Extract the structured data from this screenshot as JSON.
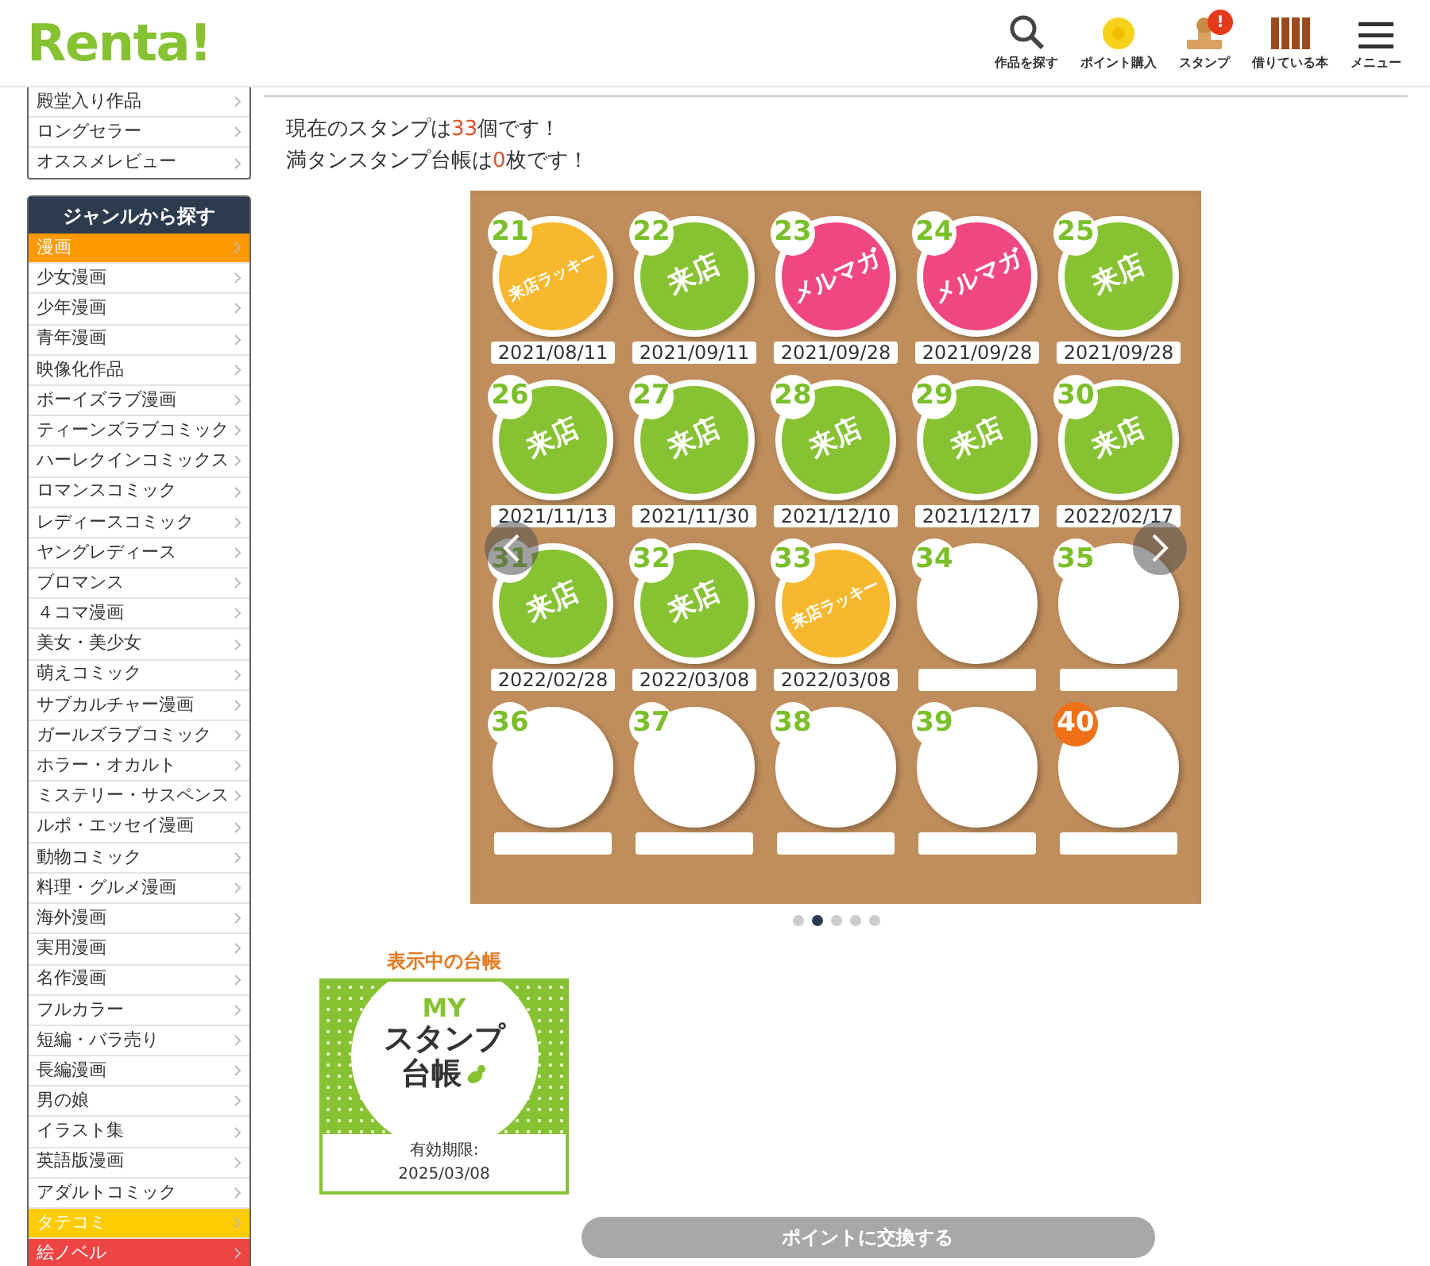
{
  "header": {
    "logo": "Renta!",
    "nav": [
      {
        "kind": "search",
        "label": "作品を探す"
      },
      {
        "kind": "coin",
        "label": "ポイント購入"
      },
      {
        "kind": "stamp",
        "label": "スタンプ",
        "badge": "!"
      },
      {
        "kind": "books",
        "label": "借りている本"
      },
      {
        "kind": "menu",
        "label": "メニュー"
      }
    ]
  },
  "sidebar": {
    "top_items": [
      {
        "label": "殿堂入り作品"
      },
      {
        "label": "ロングセラー"
      },
      {
        "label": "オススメレビュー"
      }
    ],
    "genre_title": "ジャンルから探す",
    "genres": [
      {
        "label": "漫画",
        "color": "#ff9900"
      },
      {
        "label": "少女漫画"
      },
      {
        "label": "少年漫画"
      },
      {
        "label": "青年漫画"
      },
      {
        "label": "映像化作品"
      },
      {
        "label": "ボーイズラブ漫画"
      },
      {
        "label": "ティーンズラブコミック"
      },
      {
        "label": "ハーレクインコミックス"
      },
      {
        "label": "ロマンスコミック"
      },
      {
        "label": "レディースコミック"
      },
      {
        "label": "ヤングレディース"
      },
      {
        "label": "ブロマンス"
      },
      {
        "label": "４コマ漫画"
      },
      {
        "label": "美女・美少女"
      },
      {
        "label": "萌えコミック"
      },
      {
        "label": "サブカルチャー漫画"
      },
      {
        "label": "ガールズラブコミック"
      },
      {
        "label": "ホラー・オカルト"
      },
      {
        "label": "ミステリー・サスペンス"
      },
      {
        "label": "ルポ・エッセイ漫画"
      },
      {
        "label": "動物コミック"
      },
      {
        "label": "料理・グルメ漫画"
      },
      {
        "label": "海外漫画"
      },
      {
        "label": "実用漫画"
      },
      {
        "label": "名作漫画"
      },
      {
        "label": "フルカラー"
      },
      {
        "label": "短編・バラ売り"
      },
      {
        "label": "長編漫画"
      },
      {
        "label": "男の娘"
      },
      {
        "label": "イラスト集"
      },
      {
        "label": "英語版漫画"
      },
      {
        "label": "アダルトコミック"
      },
      {
        "label": "タテコミ",
        "color": "#ffcc00"
      },
      {
        "label": "絵ノベル",
        "color": "#ee4444"
      }
    ]
  },
  "summary": [
    {
      "before": "現在のスタンプは",
      "count": "33",
      "after": "個です！"
    },
    {
      "before": "満タンスタンプ台帳は",
      "count": "0",
      "after": "枚です！"
    }
  ],
  "stamps": [
    {
      "number": "21",
      "kind": "lucky",
      "text": "来店ラッキー",
      "date": "2021/08/11"
    },
    {
      "number": "22",
      "kind": "visit",
      "text": "来店",
      "date": "2021/09/11"
    },
    {
      "number": "23",
      "kind": "newsletter",
      "text": "メルマガ",
      "date": "2021/09/28"
    },
    {
      "number": "24",
      "kind": "newsletter",
      "text": "メルマガ",
      "date": "2021/09/28"
    },
    {
      "number": "25",
      "kind": "visit",
      "text": "来店",
      "date": "2021/09/28"
    },
    {
      "number": "26",
      "kind": "visit",
      "text": "来店",
      "date": "2021/11/13"
    },
    {
      "number": "27",
      "kind": "visit",
      "text": "来店",
      "date": "2021/11/30"
    },
    {
      "number": "28",
      "kind": "visit",
      "text": "来店",
      "date": "2021/12/10"
    },
    {
      "number": "29",
      "kind": "visit",
      "text": "来店",
      "date": "2021/12/17"
    },
    {
      "number": "30",
      "kind": "visit",
      "text": "来店",
      "date": "2022/02/17"
    },
    {
      "number": "31",
      "kind": "visit",
      "text": "来店",
      "date": "2022/02/28"
    },
    {
      "number": "32",
      "kind": "visit",
      "text": "来店",
      "date": "2022/03/08"
    },
    {
      "number": "33",
      "kind": "lucky",
      "text": "来店ラッキー",
      "date": "2022/03/08"
    },
    {
      "number": "34",
      "kind": "empty"
    },
    {
      "number": "35",
      "kind": "empty"
    },
    {
      "number": "36",
      "kind": "empty"
    },
    {
      "number": "37",
      "kind": "empty"
    },
    {
      "number": "38",
      "kind": "empty"
    },
    {
      "number": "39",
      "kind": "empty"
    },
    {
      "number": "40",
      "kind": "goal"
    }
  ],
  "pager": [
    {
      "selected": false
    },
    {
      "selected": true
    },
    {
      "selected": false
    },
    {
      "selected": false
    },
    {
      "selected": false
    }
  ],
  "current_card": {
    "heading": "表示中の台帳",
    "my": "MY",
    "title_1": "スタンプ",
    "title_2": "台帳",
    "expiry_label": "有効期限:",
    "expiry": "2025/03/08"
  },
  "exchange_button": {
    "label": "ポイントに交換する",
    "disabled": true
  }
}
